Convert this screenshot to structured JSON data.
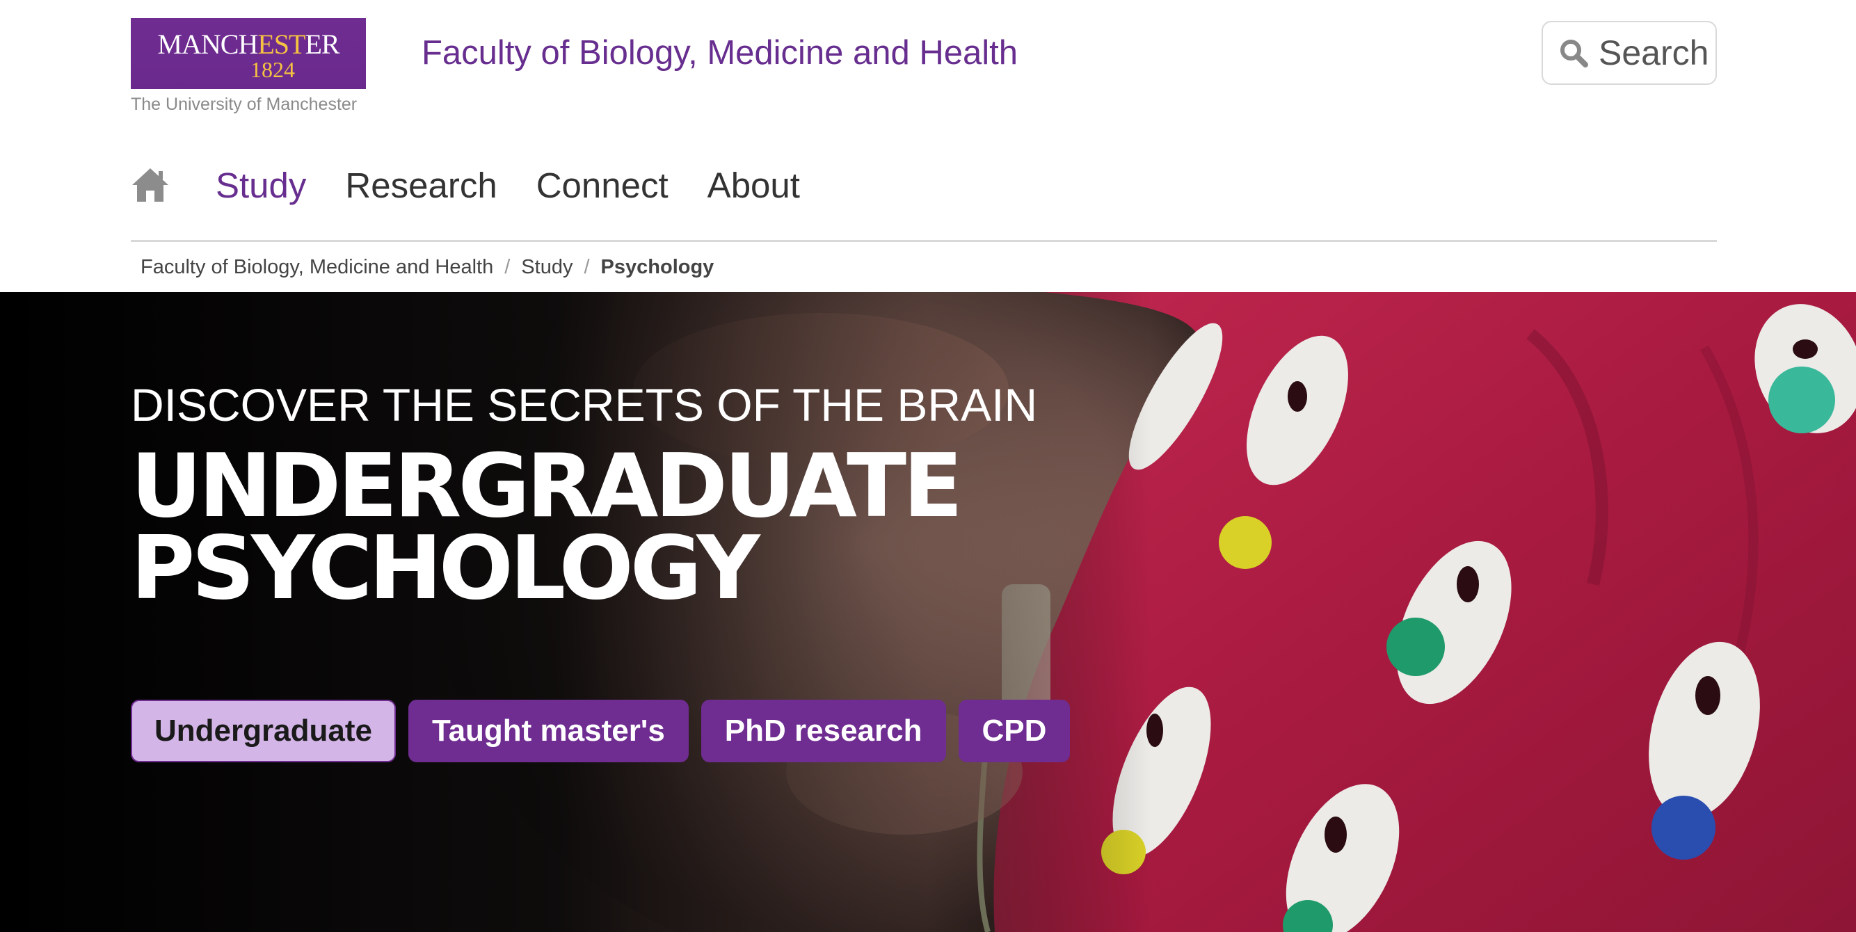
{
  "header": {
    "logo": {
      "wordmark_part1": "MANCH",
      "wordmark_part2": "EST",
      "wordmark_part3": "ER",
      "year": "1824",
      "subtitle": "The University of Manchester"
    },
    "faculty_title": "Faculty of Biology, Medicine and Health",
    "search": {
      "label": "Search",
      "icon": "search-icon"
    }
  },
  "nav": {
    "home_icon": "home-icon",
    "items": [
      {
        "label": "Study",
        "active": true
      },
      {
        "label": "Research",
        "active": false
      },
      {
        "label": "Connect",
        "active": false
      },
      {
        "label": "About",
        "active": false
      }
    ]
  },
  "breadcrumb": {
    "items": [
      "Faculty of Biology, Medicine and Health",
      "Study"
    ],
    "separator": "/",
    "current": "Psychology"
  },
  "hero": {
    "kicker": "DISCOVER THE SECRETS OF THE BRAIN",
    "title_line1": "UNDERGRADUATE",
    "title_line2": "PSYCHOLOGY",
    "buttons": [
      {
        "label": "Undergraduate",
        "selected": true
      },
      {
        "label": "Taught master's",
        "selected": false
      },
      {
        "label": "PhD research",
        "selected": false
      },
      {
        "label": "CPD",
        "selected": false
      }
    ]
  },
  "colors": {
    "brand_purple": "#672e8f",
    "button_purple": "#6f2c91",
    "selected_button": "#d4b5e8",
    "gold": "#f5c242",
    "hero_cap_red": "#b01e47"
  }
}
